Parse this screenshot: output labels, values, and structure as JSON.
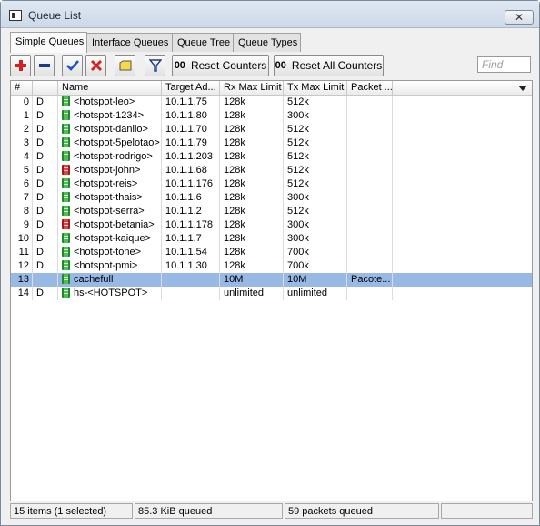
{
  "window": {
    "title": "Queue List",
    "close_label": "✕"
  },
  "tabs": [
    {
      "label": "Simple Queues",
      "active": true
    },
    {
      "label": "Interface Queues",
      "active": false
    },
    {
      "label": "Queue Tree",
      "active": false
    },
    {
      "label": "Queue Types",
      "active": false
    }
  ],
  "toolbar": {
    "reset_counters_prefix": "00",
    "reset_counters_label": "Reset Counters",
    "reset_all_prefix": "00",
    "reset_all_label": "Reset All Counters",
    "find_placeholder": "Find",
    "colors": {
      "add": "#d42020",
      "remove": "#1b3a8a",
      "enable": "#1a55c8",
      "disable": "#d42020",
      "comment": "#f5d94a"
    }
  },
  "table": {
    "columns": [
      "#",
      "",
      "Name",
      "Target Ad...",
      "Rx Max Limit",
      "Tx Max Limit",
      "Packet ..."
    ],
    "rows": [
      {
        "num": "0",
        "flag": "D",
        "icon": "green",
        "name": "<hotspot-leo>",
        "target": "10.1.1.75",
        "rx": "128k",
        "tx": "512k",
        "packet": ""
      },
      {
        "num": "1",
        "flag": "D",
        "icon": "green",
        "name": "<hotspot-1234>",
        "target": "10.1.1.80",
        "rx": "128k",
        "tx": "300k",
        "packet": ""
      },
      {
        "num": "2",
        "flag": "D",
        "icon": "green",
        "name": "<hotspot-danilo>",
        "target": "10.1.1.70",
        "rx": "128k",
        "tx": "512k",
        "packet": ""
      },
      {
        "num": "3",
        "flag": "D",
        "icon": "green",
        "name": "<hotspot-5pelotao>",
        "target": "10.1.1.79",
        "rx": "128k",
        "tx": "512k",
        "packet": ""
      },
      {
        "num": "4",
        "flag": "D",
        "icon": "green",
        "name": "<hotspot-rodrigo>",
        "target": "10.1.1.203",
        "rx": "128k",
        "tx": "512k",
        "packet": ""
      },
      {
        "num": "5",
        "flag": "D",
        "icon": "red",
        "name": "<hotspot-john>",
        "target": "10.1.1.68",
        "rx": "128k",
        "tx": "512k",
        "packet": ""
      },
      {
        "num": "6",
        "flag": "D",
        "icon": "green",
        "name": "<hotspot-reis>",
        "target": "10.1.1.176",
        "rx": "128k",
        "tx": "512k",
        "packet": ""
      },
      {
        "num": "7",
        "flag": "D",
        "icon": "green",
        "name": "<hotspot-thais>",
        "target": "10.1.1.6",
        "rx": "128k",
        "tx": "300k",
        "packet": ""
      },
      {
        "num": "8",
        "flag": "D",
        "icon": "green",
        "name": "<hotspot-serra>",
        "target": "10.1.1.2",
        "rx": "128k",
        "tx": "512k",
        "packet": ""
      },
      {
        "num": "9",
        "flag": "D",
        "icon": "red",
        "name": "<hotspot-betania>",
        "target": "10.1.1.178",
        "rx": "128k",
        "tx": "300k",
        "packet": ""
      },
      {
        "num": "10",
        "flag": "D",
        "icon": "green",
        "name": "<hotspot-kaique>",
        "target": "10.1.1.7",
        "rx": "128k",
        "tx": "300k",
        "packet": ""
      },
      {
        "num": "11",
        "flag": "D",
        "icon": "green",
        "name": "<hotspot-tone>",
        "target": "10.1.1.54",
        "rx": "128k",
        "tx": "700k",
        "packet": ""
      },
      {
        "num": "12",
        "flag": "D",
        "icon": "green",
        "name": "<hotspot-pmi>",
        "target": "10.1.1.30",
        "rx": "128k",
        "tx": "700k",
        "packet": ""
      },
      {
        "num": "13",
        "flag": "",
        "icon": "green",
        "name": "cachefull",
        "target": "",
        "rx": "10M",
        "tx": "10M",
        "packet": "Pacote...",
        "selected": true
      },
      {
        "num": "14",
        "flag": "D",
        "icon": "green",
        "name": "hs-<HOTSPOT>",
        "target": "",
        "rx": "unlimited",
        "tx": "unlimited",
        "packet": ""
      }
    ]
  },
  "status": {
    "items": "15 items (1 selected)",
    "queued": "85.3 KiB queued",
    "packets": "59 packets queued",
    "extra": ""
  }
}
